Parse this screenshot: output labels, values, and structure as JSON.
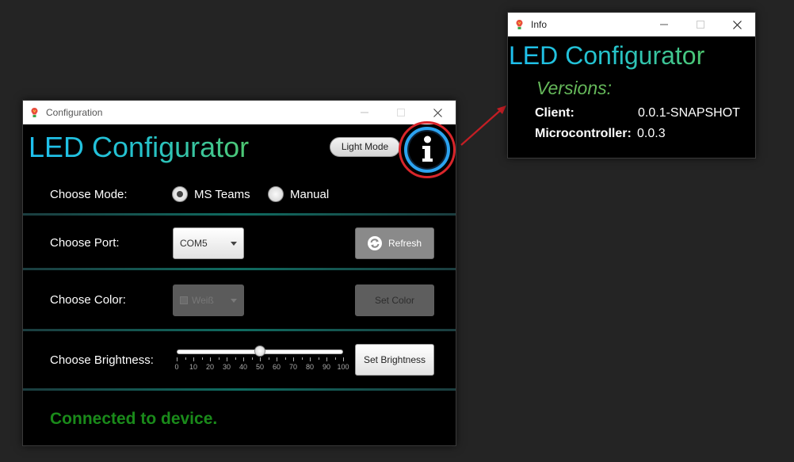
{
  "main_window": {
    "title": "Configuration",
    "app_title": "LED Configurator",
    "light_mode_label": "Light Mode",
    "mode": {
      "label": "Choose Mode:",
      "options": [
        {
          "label": "MS Teams",
          "selected": true
        },
        {
          "label": "Manual",
          "selected": false
        }
      ]
    },
    "port": {
      "label": "Choose Port:",
      "selected": "COM5",
      "refresh_label": "Refresh"
    },
    "color": {
      "label": "Choose Color:",
      "selected": "Weiß",
      "set_label": "Set Color",
      "enabled": false
    },
    "brightness": {
      "label": "Choose Brightness:",
      "value": 50,
      "min": 0,
      "max": 100,
      "tick_labels": [
        "0",
        "10",
        "20",
        "30",
        "40",
        "50",
        "60",
        "70",
        "80",
        "90",
        "100"
      ],
      "set_label": "Set Brightness"
    },
    "status": "Connected to device."
  },
  "info_window": {
    "title": "Info",
    "app_title": "LED Configurator",
    "versions_heading": "Versions:",
    "client_label": "Client:",
    "client_value": "0.0.1-SNAPSHOT",
    "micro_label": "Microcontroller:",
    "micro_value": "0.0.3"
  },
  "colors": {
    "background": "#242424",
    "accent_red": "#d9262b",
    "status_green": "#1a8a1a",
    "title_gradient_start": "#1ec0ef",
    "title_gradient_end": "#4ec870"
  },
  "icons": [
    "app-bulb-icon",
    "minimize-icon",
    "maximize-icon",
    "close-icon",
    "info-icon",
    "refresh-icon",
    "dropdown-arrow-icon"
  ]
}
